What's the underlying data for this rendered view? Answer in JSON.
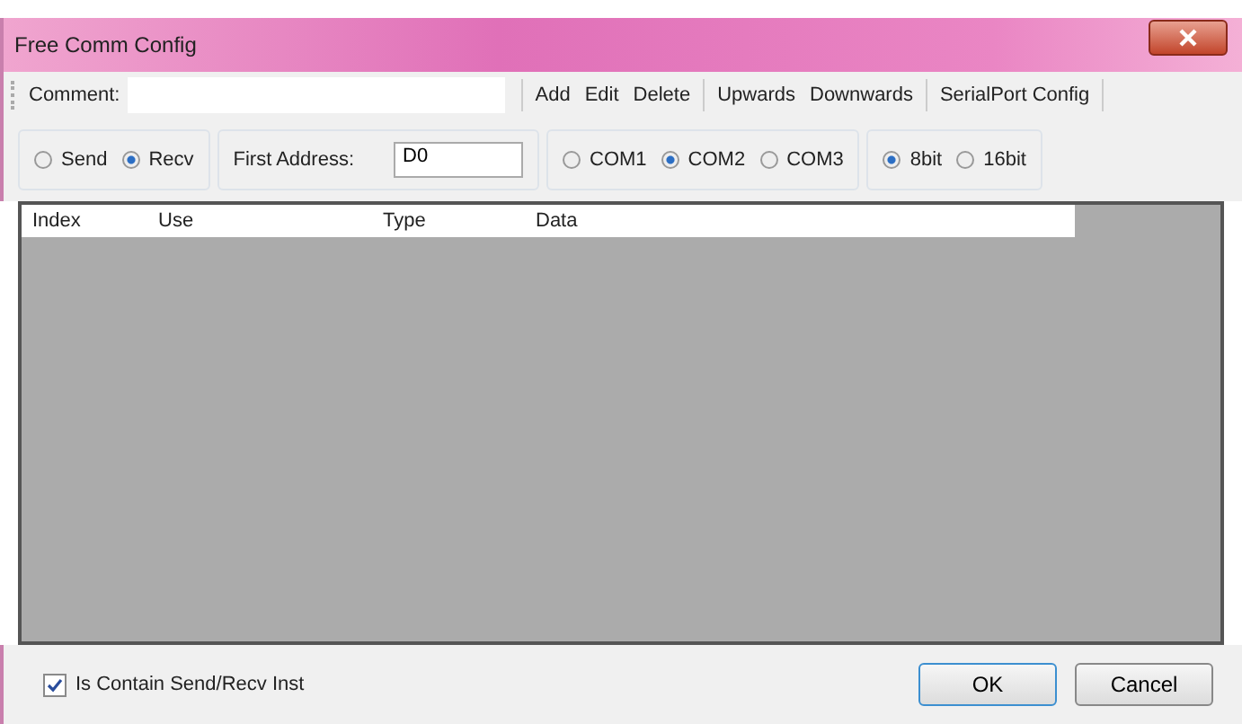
{
  "window": {
    "title": "Free Comm Config"
  },
  "toolbar": {
    "comment_label": "Comment:",
    "sections": [
      [
        "Add",
        "Edit",
        "Delete"
      ],
      [
        "Upwards",
        "Downwards"
      ],
      [
        "SerialPort Config"
      ]
    ]
  },
  "groups": [
    {
      "kind": "radios",
      "options": [
        {
          "label": "Send",
          "selected": false
        },
        {
          "label": "Recv",
          "selected": true
        }
      ]
    },
    {
      "kind": "field",
      "label": "First Address:",
      "value": "D0"
    },
    {
      "kind": "radios",
      "options": [
        {
          "label": "COM1",
          "selected": false
        },
        {
          "label": "COM2",
          "selected": true
        },
        {
          "label": "COM3",
          "selected": false
        }
      ]
    },
    {
      "kind": "radios",
      "options": [
        {
          "label": "8bit",
          "selected": true
        },
        {
          "label": "16bit",
          "selected": false
        }
      ]
    }
  ],
  "table": {
    "columns": [
      "Index",
      "Use",
      "Type",
      "Data"
    ]
  },
  "footer": {
    "checkbox": {
      "label": "Is Contain Send/Recv Inst",
      "checked": true
    },
    "buttons": [
      "OK",
      "Cancel"
    ]
  }
}
